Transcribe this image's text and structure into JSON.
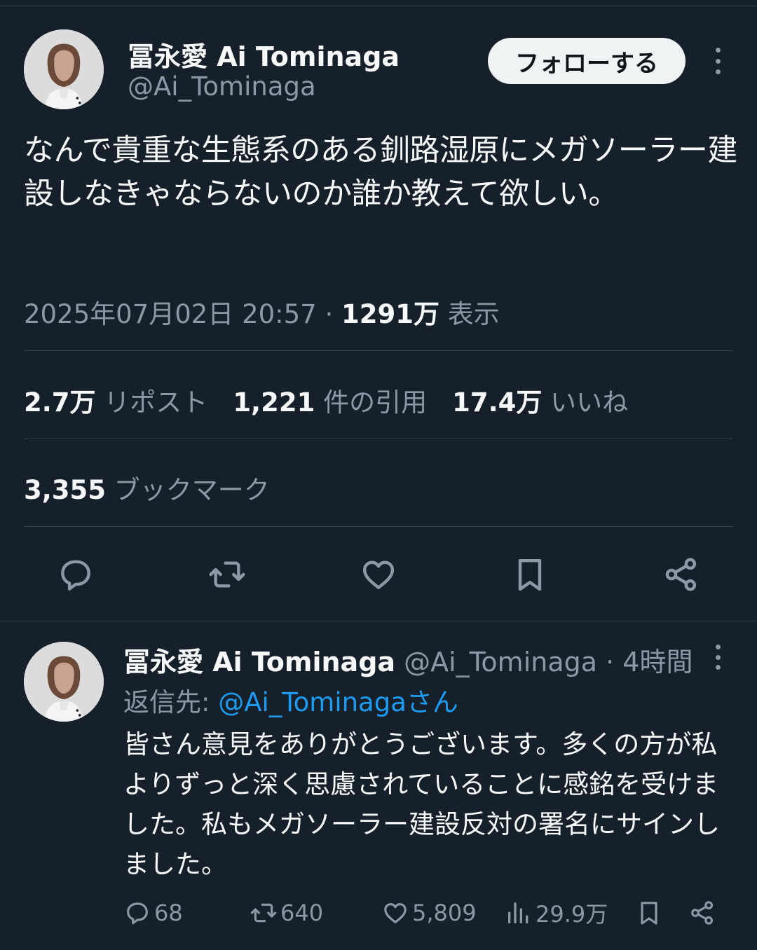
{
  "main_tweet": {
    "author_name": "冨永愛 Ai Tominaga",
    "author_handle": "@Ai_Tominaga",
    "follow_label": "フォローする",
    "text": "なんで貴重な生態系のある釧路湿原にメガソーラー建設しなきゃならないのか誰か教えて欲しい。",
    "timestamp": "2025年07月02日 20:57",
    "separator": " · ",
    "views_count": "1291万",
    "views_label": " 表示",
    "reposts_count": "2.7万",
    "reposts_label": " リポスト",
    "quotes_count": "1,221",
    "quotes_label": " 件の引用",
    "likes_count": "17.4万",
    "likes_label": " いいね",
    "bookmarks_count": "3,355",
    "bookmarks_label": " ブックマーク",
    "icons": [
      "reply-icon",
      "repost-icon",
      "like-icon",
      "bookmark-icon",
      "share-icon"
    ]
  },
  "reply": {
    "author_name": "冨永愛 Ai Tominaga",
    "author_handle": " @Ai_Tominaga",
    "time": " · 4時間",
    "reply_prefix": "返信先: ",
    "reply_mention": "@Ai_Tominagaさん",
    "text": "皆さん意見をありがとうございます。多くの方が私よりずっと深く思慮されていることに感銘を受けました。私もメガソーラー建設反対の署名にサインしました。",
    "replies": "68",
    "reposts": "640",
    "likes": "5,809",
    "views": "29.9万"
  },
  "colors": {
    "background": "#15202b",
    "text": "#f7f9f9",
    "secondary": "#8b98a5",
    "accent": "#1d9bf0",
    "divider": "#38444d"
  }
}
